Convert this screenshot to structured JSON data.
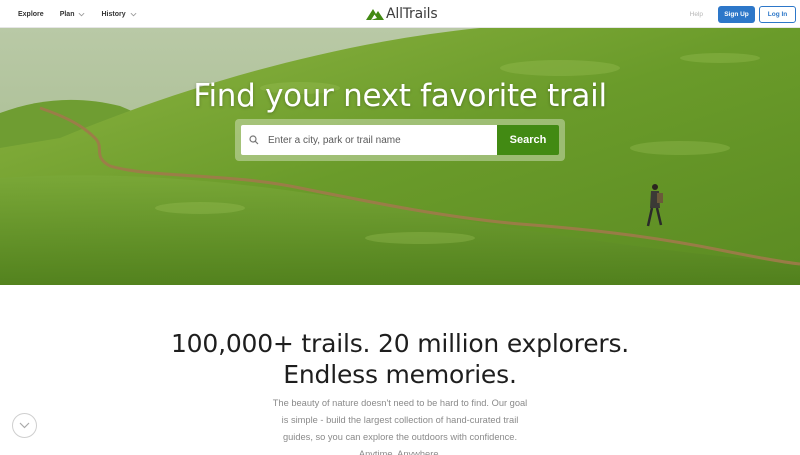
{
  "nav": {
    "items": [
      {
        "label": "Explore",
        "has_dropdown": false
      },
      {
        "label": "Plan",
        "has_dropdown": true
      },
      {
        "label": "History",
        "has_dropdown": true
      }
    ],
    "logo_text": "AllTrails",
    "help_label": "Help",
    "signup_label": "Sign Up",
    "login_label": "Log In"
  },
  "hero": {
    "title": "Find your next favorite trail",
    "search_placeholder": "Enter a city, park or trail name",
    "search_button": "Search"
  },
  "content": {
    "headline_line1": "100,000+ trails. 20 million explorers.",
    "headline_line2": "Endless memories.",
    "description": "The beauty of nature doesn't need to be hard to find. Our goal is simple - build the largest collection of hand-curated trail guides, so you can explore the outdoors with confidence. Anytime. Anywhere."
  },
  "icons": {
    "logo": "alltrails-mountain-icon",
    "search": "search-icon",
    "dropdown": "chevron-down-icon",
    "scroll": "scroll-down-icon"
  },
  "colors": {
    "brand_green": "#428a13",
    "signup_blue": "#2d77c9",
    "hero_grass": "#6b9b2c"
  }
}
